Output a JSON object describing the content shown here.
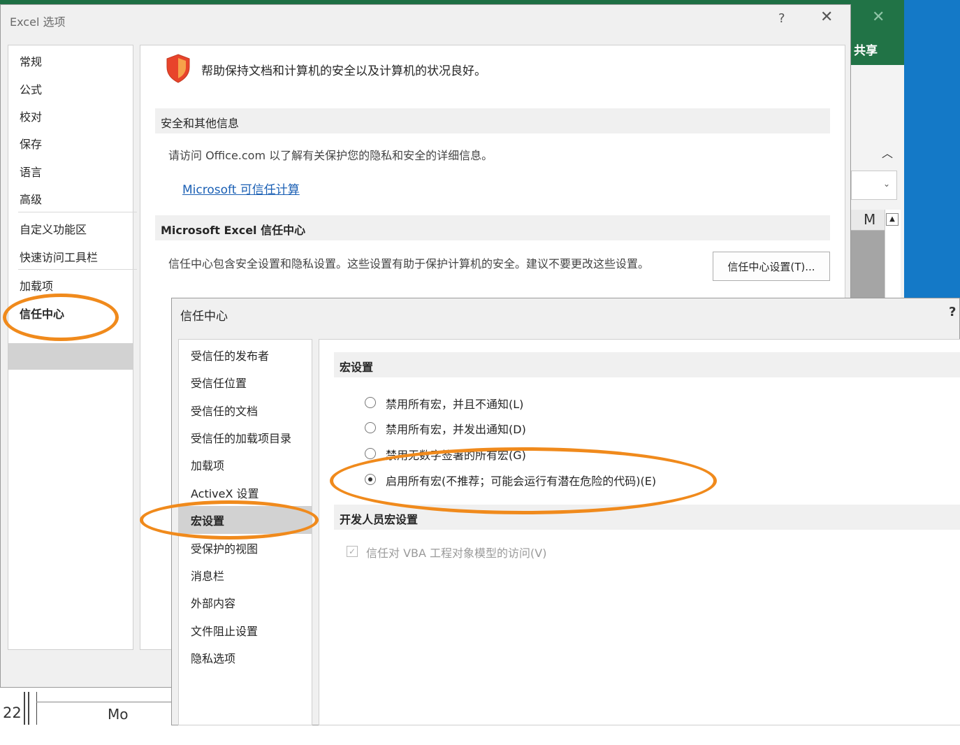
{
  "background_window": {
    "share_label": "共享",
    "close_glyph": "✕",
    "caret_glyph": "︿",
    "combo_chevron": "⌄",
    "column_header": "M",
    "row_number": "22",
    "cell_value": "Mo"
  },
  "options_dialog": {
    "title": "Excel 选项",
    "help_glyph": "?",
    "close_glyph": "✕",
    "nav": {
      "items": [
        "常规",
        "公式",
        "校对",
        "保存",
        "语言",
        "高级",
        "自定义功能区",
        "快速访问工具栏",
        "加载项",
        "信任中心"
      ],
      "selected": "信任中心"
    },
    "heading": "帮助保持文档和计算机的安全以及计算机的状况良好。",
    "security_section": {
      "title": "安全和其他信息",
      "text": "请访问 Office.com 以了解有关保护您的隐私和安全的详细信息。",
      "link": "Microsoft 可信任计算"
    },
    "trust_center_section": {
      "title": "Microsoft Excel 信任中心",
      "text": "信任中心包含安全设置和隐私设置。这些设置有助于保护计算机的安全。建议不要更改这些设置。",
      "button": "信任中心设置(T)..."
    }
  },
  "trust_center_dialog": {
    "title": "信任中心",
    "help_glyph": "?",
    "nav": {
      "items": [
        "受信任的发布者",
        "受信任位置",
        "受信任的文档",
        "受信任的加载项目录",
        "加载项",
        "ActiveX 设置",
        "宏设置",
        "受保护的视图",
        "消息栏",
        "外部内容",
        "文件阻止设置",
        "隐私选项"
      ],
      "selected": "宏设置"
    },
    "macro_section": {
      "title": "宏设置",
      "options": [
        {
          "label": "禁用所有宏，并且不通知(L)",
          "selected": false
        },
        {
          "label": "禁用所有宏，并发出通知(D)",
          "selected": false
        },
        {
          "label": "禁用无数字签署的所有宏(G)",
          "selected": false
        },
        {
          "label": "启用所有宏(不推荐；可能会运行有潜在危险的代码)(E)",
          "selected": true
        }
      ]
    },
    "developer_section": {
      "title": "开发人员宏设置",
      "vba_access": {
        "label": "信任对 VBA 工程对象模型的访问(V)",
        "checked": true,
        "enabled": false,
        "check_glyph": "✓"
      }
    }
  },
  "colors": {
    "accent_orange": "#f08a1c",
    "excel_green": "#217346",
    "link_blue": "#1a5fb4",
    "shield_red": "#e8442b"
  }
}
